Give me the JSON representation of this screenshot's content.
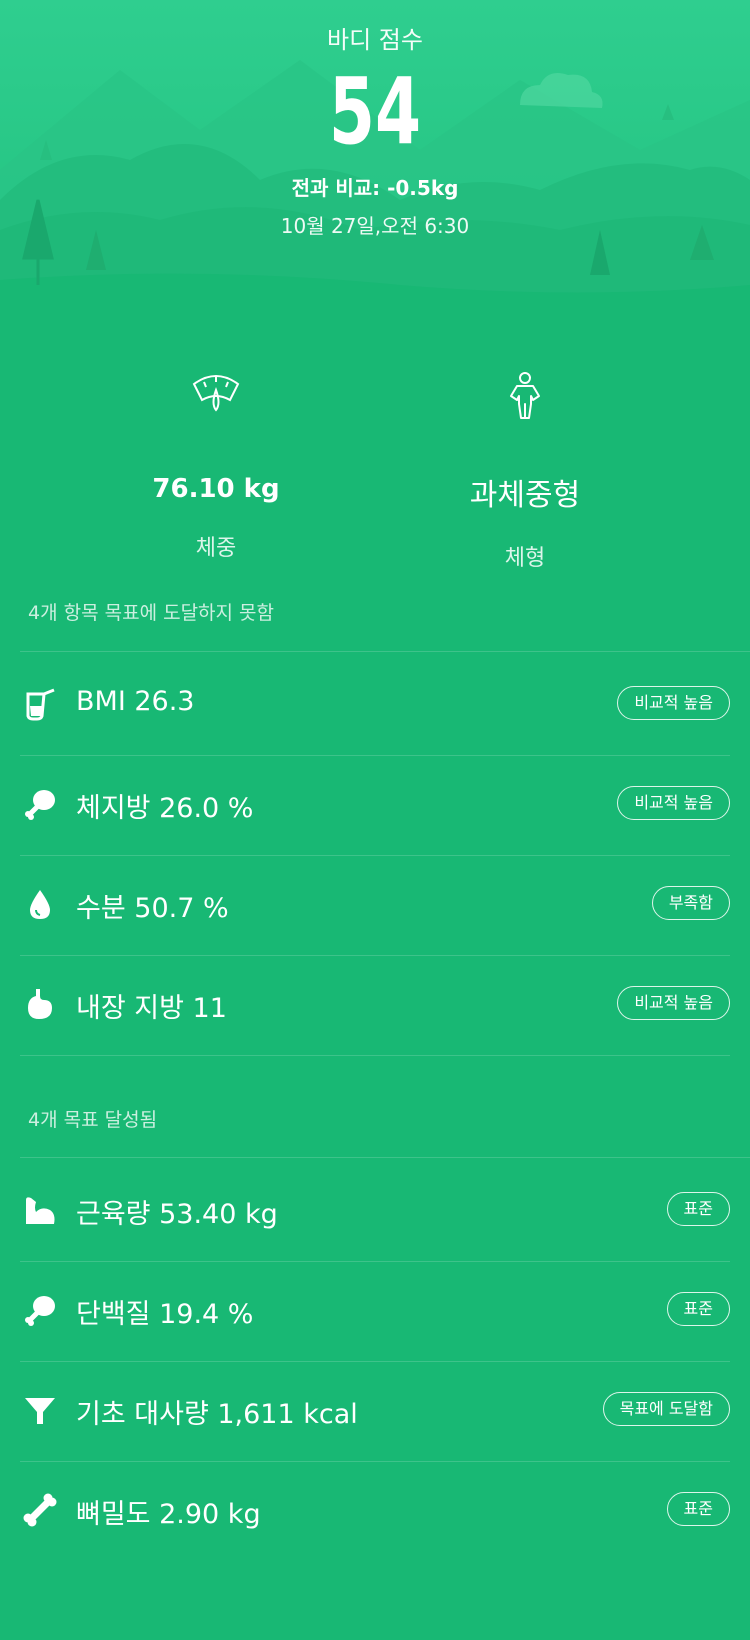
{
  "header": {
    "title": "바디 점수",
    "score": "54",
    "comparison": "전과 비교: -0.5kg",
    "datetime": "10월 27일,오전 6:30"
  },
  "summary": {
    "weight": {
      "value": "76.10 kg",
      "label": "체중",
      "icon": "scale-icon"
    },
    "body_type": {
      "value": "과체중형",
      "label": "체형",
      "icon": "body-figure-icon"
    }
  },
  "unmet_section": {
    "heading": "4개 항목 목표에 도달하지 못함",
    "items": [
      {
        "label": "BMI 26.3",
        "badge": "비교적 높음",
        "icon": "beaker-icon"
      },
      {
        "label": "체지방 26.0 %",
        "badge": "비교적 높음",
        "icon": "drumstick-icon"
      },
      {
        "label": "수분 50.7 %",
        "badge": "부족함",
        "icon": "water-drop-icon"
      },
      {
        "label": "내장 지방 11",
        "badge": "비교적 높음",
        "icon": "stomach-icon"
      }
    ]
  },
  "met_section": {
    "heading": "4개 목표 달성됨",
    "items": [
      {
        "label": "근육량 53.40 kg",
        "badge": "표준",
        "icon": "muscle-icon"
      },
      {
        "label": "단백질 19.4 %",
        "badge": "표준",
        "icon": "drumstick-icon"
      },
      {
        "label": "기초 대사량 1,611 kcal",
        "badge": "목표에 도달함",
        "icon": "funnel-icon"
      },
      {
        "label": "뼈밀도 2.90 kg",
        "badge": "표준",
        "icon": "bone-icon"
      }
    ]
  },
  "colors": {
    "background": "#18b874",
    "hero_top": "#2bcc8c",
    "text": "#ffffff"
  }
}
